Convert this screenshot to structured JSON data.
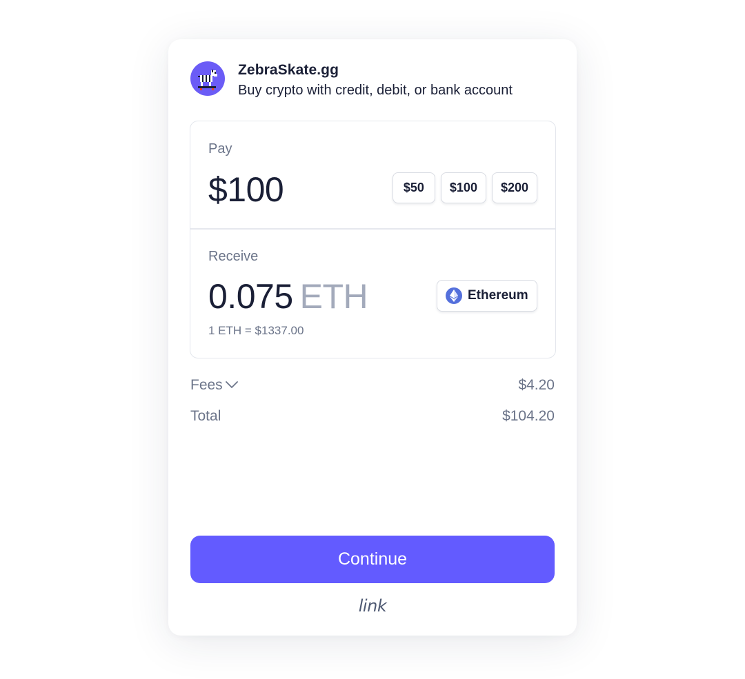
{
  "merchant": {
    "name": "ZebraSkate.gg",
    "tagline": "Buy crypto with credit, debit, or bank account",
    "logo_icon": "zebra-skateboard-icon"
  },
  "pay": {
    "label": "Pay",
    "amount": "$100",
    "presets": [
      "$50",
      "$100",
      "$200"
    ]
  },
  "receive": {
    "label": "Receive",
    "amount": "0.075",
    "unit": "ETH",
    "currency": "Ethereum",
    "currency_icon": "ethereum-icon",
    "rate": "1 ETH = $1337.00"
  },
  "fees": {
    "label": "Fees",
    "value": "$4.20"
  },
  "total": {
    "label": "Total",
    "value": "$104.20"
  },
  "continue_label": "Continue",
  "brand": "link",
  "colors": {
    "accent": "#635bff",
    "text_primary": "#1a1f36",
    "text_muted": "#6b7489",
    "eth_blue": "#5470dc"
  }
}
